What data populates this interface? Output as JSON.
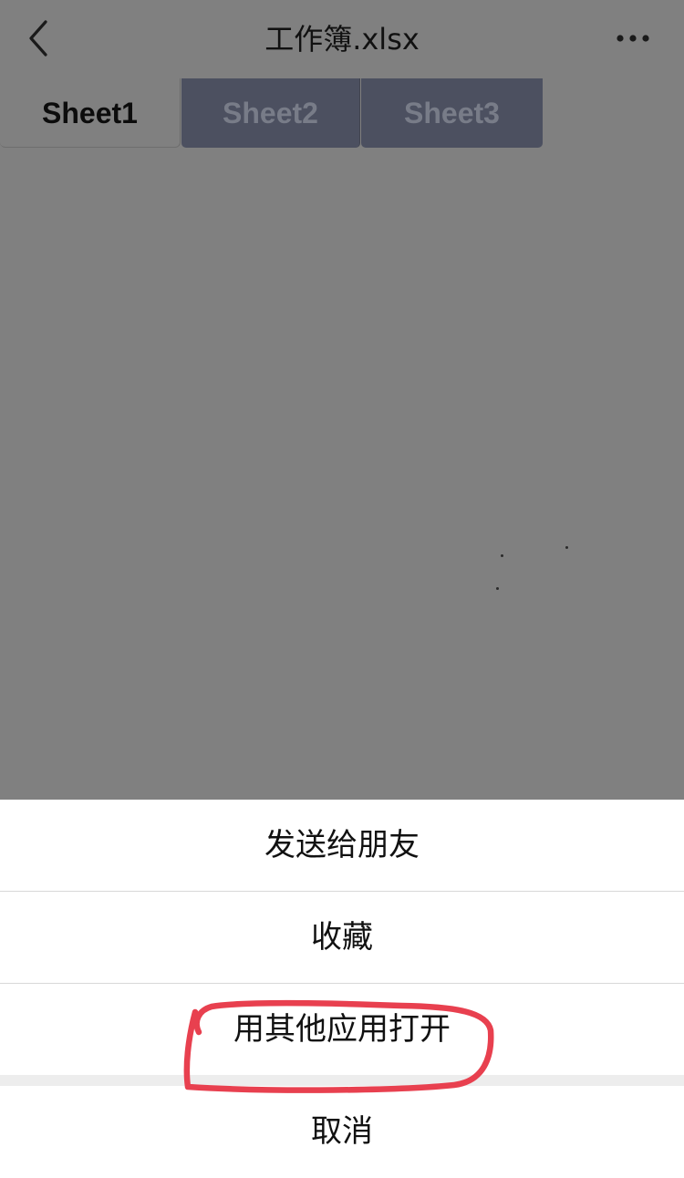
{
  "nav": {
    "title": "工作簿.xlsx",
    "back_icon": "chevron-left-icon",
    "more_icon": "more-horizontal-icon"
  },
  "tabs": [
    {
      "label": "Sheet1",
      "active": true
    },
    {
      "label": "Sheet2",
      "active": false
    },
    {
      "label": "Sheet3",
      "active": false
    }
  ],
  "action_sheet": {
    "items": [
      {
        "label": "发送给朋友"
      },
      {
        "label": "收藏"
      },
      {
        "label": "用其他应用打开"
      }
    ],
    "cancel_label": "取消"
  },
  "colors": {
    "overlay": "#808080",
    "inactive_tab": "#4c5060",
    "sheet_bg": "#ffffff",
    "annotation": "#e8404f"
  }
}
